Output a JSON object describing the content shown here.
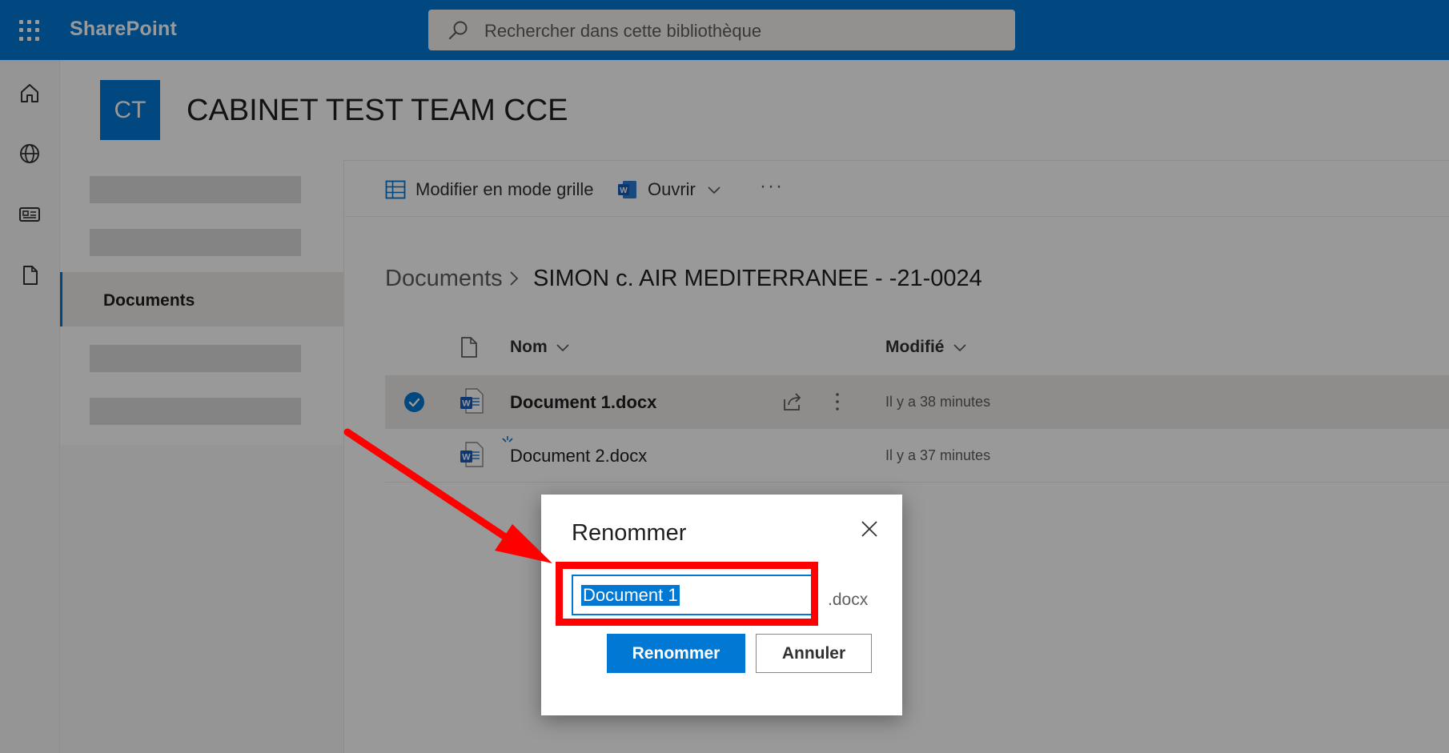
{
  "suitebar": {
    "app_name": "SharePoint",
    "search_placeholder": "Rechercher dans cette bibliothèque",
    "bg_color": "#0078d4"
  },
  "appbar": {
    "icons": [
      "home-icon",
      "globe-icon",
      "news-icon",
      "file-icon"
    ]
  },
  "site": {
    "logo_text": "CT",
    "title": "CABINET TEST TEAM CCE"
  },
  "sitenav": {
    "selected_label": "Documents"
  },
  "commandbar": {
    "grid_label": "Modifier en mode grille",
    "open_label": "Ouvrir",
    "more_label": "···"
  },
  "breadcrumb": {
    "root": "Documents",
    "current": "SIMON c. AIR MEDITERRANEE - -21-0024"
  },
  "list": {
    "columns": {
      "name": "Nom",
      "modified": "Modifié"
    },
    "rows": [
      {
        "name": "Document 1.docx",
        "modified": "Il y a 38 minutes",
        "selected": true
      },
      {
        "name": "Document 2.docx",
        "modified": "Il y a 37 minutes",
        "selected": false
      }
    ]
  },
  "dialog": {
    "title": "Renommer",
    "input_value": "Document 1",
    "extension": ".docx",
    "primary_label": "Renommer",
    "cancel_label": "Annuler"
  },
  "annotation": {
    "color": "#ff0000"
  }
}
